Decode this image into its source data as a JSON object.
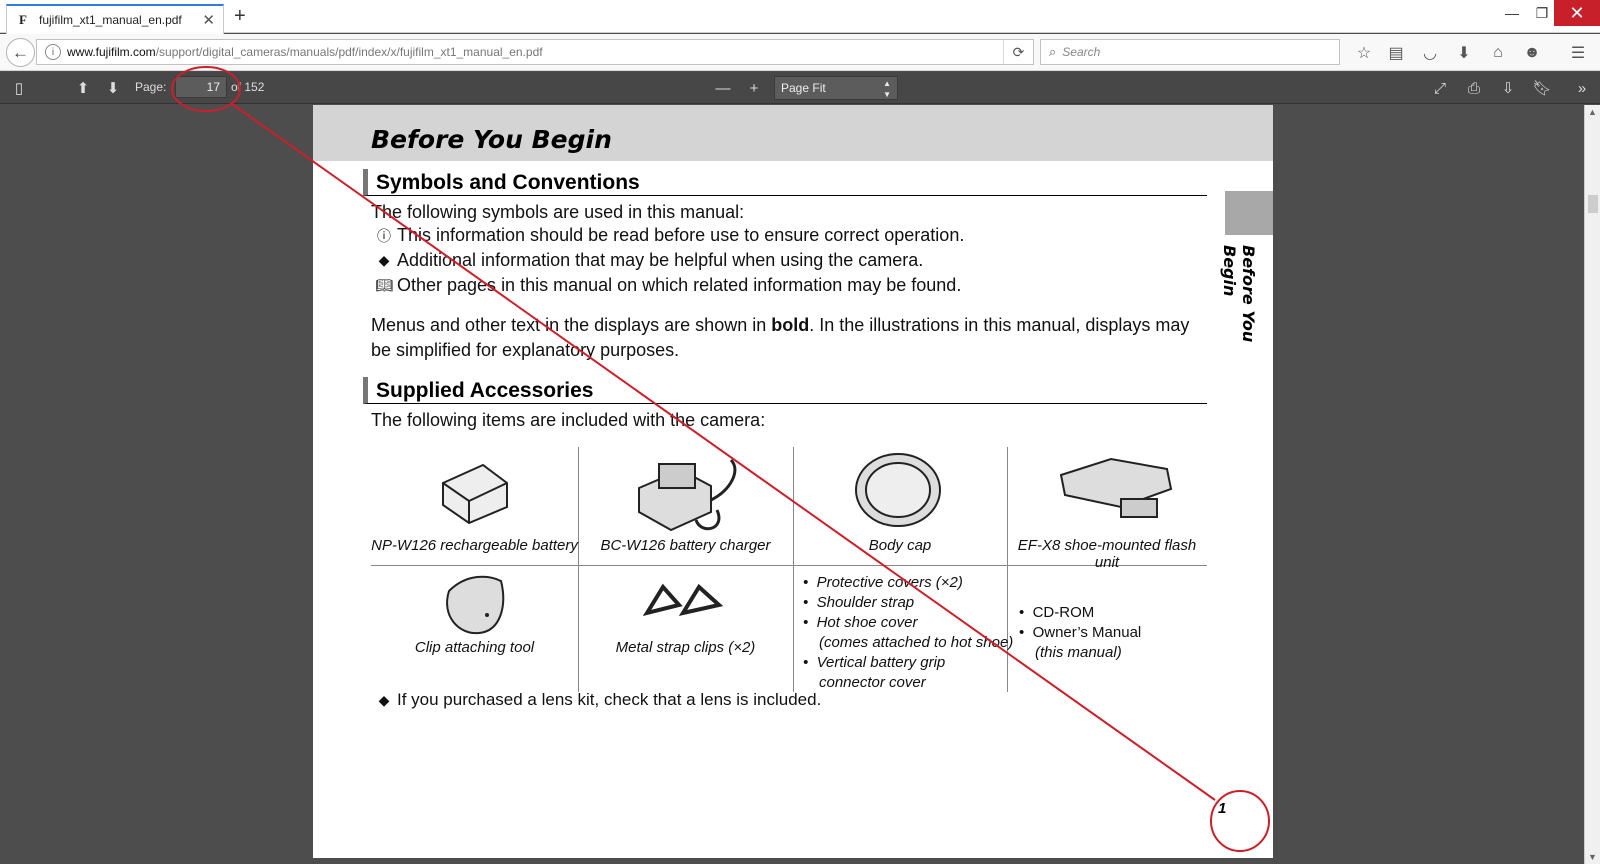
{
  "browser": {
    "tab_title": "fujifilm_xt1_manual_en.pdf",
    "tab_favicon": "F",
    "new_tab_label": "+",
    "url_host": "www.fujifilm.com",
    "url_path": "/support/digital_cameras/manuals/pdf/index/x/fujifilm_xt1_manual_en.pdf",
    "search_placeholder": "Search"
  },
  "pdf_toolbar": {
    "page_label": "Page:",
    "page_value": "17",
    "page_total": "of 152",
    "zoom_value": "Page Fit"
  },
  "page": {
    "header_title": "Before You Begin",
    "side_label": "Before You Begin",
    "section1_title": "Symbols and Conventions",
    "section1_intro": "The following symbols are used in this manual:",
    "symbol_lines": [
      "This information should be read before use to ensure correct operation.",
      "Additional information that may be helpful when using the camera.",
      "Other pages in this manual on which related information may be found."
    ],
    "menus_text_pre": "Menus and other text in the displays are shown in ",
    "menus_text_bold": "bold",
    "menus_text_post": ".  In the illustrations in this manual, displays may",
    "menus_text_line2": "be simplified for explanatory purposes.",
    "section2_title": "Supplied Accessories",
    "section2_intro": "The following items are included with the camera:",
    "accessories_row1": [
      "NP-W126 rechargeable battery",
      "BC-W126 battery charger",
      "Body cap",
      "EF-X8 shoe-mounted flash unit"
    ],
    "accessories_row2": [
      "Clip attaching tool",
      "Metal strap clips (×2)"
    ],
    "accessories_list_italic": [
      "Protective covers (×2)",
      "Shoulder strap",
      "Hot shoe cover",
      "(comes attached to hot shoe)",
      "Vertical battery grip",
      "connector cover"
    ],
    "accessories_list_plain": [
      "CD-ROM",
      "Owner’s Manual",
      "(this manual)"
    ],
    "lens_note": "If you purchased a lens kit, check that a lens is included.",
    "page_number": "1"
  },
  "colors": {
    "annotation_red": "#cc1f2a",
    "tab_accent": "#2f7ed8",
    "toolbar_bg": "#474747",
    "viewer_bg": "#4d4d4d"
  }
}
